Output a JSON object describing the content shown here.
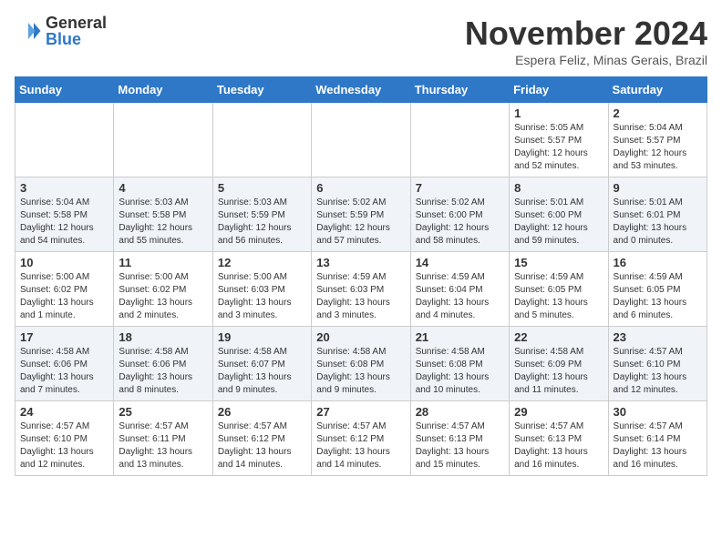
{
  "logo": {
    "general": "General",
    "blue": "Blue"
  },
  "header": {
    "month": "November 2024",
    "location": "Espera Feliz, Minas Gerais, Brazil"
  },
  "weekdays": [
    "Sunday",
    "Monday",
    "Tuesday",
    "Wednesday",
    "Thursday",
    "Friday",
    "Saturday"
  ],
  "weeks": [
    [
      {
        "day": "",
        "info": ""
      },
      {
        "day": "",
        "info": ""
      },
      {
        "day": "",
        "info": ""
      },
      {
        "day": "",
        "info": ""
      },
      {
        "day": "",
        "info": ""
      },
      {
        "day": "1",
        "info": "Sunrise: 5:05 AM\nSunset: 5:57 PM\nDaylight: 12 hours\nand 52 minutes."
      },
      {
        "day": "2",
        "info": "Sunrise: 5:04 AM\nSunset: 5:57 PM\nDaylight: 12 hours\nand 53 minutes."
      }
    ],
    [
      {
        "day": "3",
        "info": "Sunrise: 5:04 AM\nSunset: 5:58 PM\nDaylight: 12 hours\nand 54 minutes."
      },
      {
        "day": "4",
        "info": "Sunrise: 5:03 AM\nSunset: 5:58 PM\nDaylight: 12 hours\nand 55 minutes."
      },
      {
        "day": "5",
        "info": "Sunrise: 5:03 AM\nSunset: 5:59 PM\nDaylight: 12 hours\nand 56 minutes."
      },
      {
        "day": "6",
        "info": "Sunrise: 5:02 AM\nSunset: 5:59 PM\nDaylight: 12 hours\nand 57 minutes."
      },
      {
        "day": "7",
        "info": "Sunrise: 5:02 AM\nSunset: 6:00 PM\nDaylight: 12 hours\nand 58 minutes."
      },
      {
        "day": "8",
        "info": "Sunrise: 5:01 AM\nSunset: 6:00 PM\nDaylight: 12 hours\nand 59 minutes."
      },
      {
        "day": "9",
        "info": "Sunrise: 5:01 AM\nSunset: 6:01 PM\nDaylight: 13 hours\nand 0 minutes."
      }
    ],
    [
      {
        "day": "10",
        "info": "Sunrise: 5:00 AM\nSunset: 6:02 PM\nDaylight: 13 hours\nand 1 minute."
      },
      {
        "day": "11",
        "info": "Sunrise: 5:00 AM\nSunset: 6:02 PM\nDaylight: 13 hours\nand 2 minutes."
      },
      {
        "day": "12",
        "info": "Sunrise: 5:00 AM\nSunset: 6:03 PM\nDaylight: 13 hours\nand 3 minutes."
      },
      {
        "day": "13",
        "info": "Sunrise: 4:59 AM\nSunset: 6:03 PM\nDaylight: 13 hours\nand 3 minutes."
      },
      {
        "day": "14",
        "info": "Sunrise: 4:59 AM\nSunset: 6:04 PM\nDaylight: 13 hours\nand 4 minutes."
      },
      {
        "day": "15",
        "info": "Sunrise: 4:59 AM\nSunset: 6:05 PM\nDaylight: 13 hours\nand 5 minutes."
      },
      {
        "day": "16",
        "info": "Sunrise: 4:59 AM\nSunset: 6:05 PM\nDaylight: 13 hours\nand 6 minutes."
      }
    ],
    [
      {
        "day": "17",
        "info": "Sunrise: 4:58 AM\nSunset: 6:06 PM\nDaylight: 13 hours\nand 7 minutes."
      },
      {
        "day": "18",
        "info": "Sunrise: 4:58 AM\nSunset: 6:06 PM\nDaylight: 13 hours\nand 8 minutes."
      },
      {
        "day": "19",
        "info": "Sunrise: 4:58 AM\nSunset: 6:07 PM\nDaylight: 13 hours\nand 9 minutes."
      },
      {
        "day": "20",
        "info": "Sunrise: 4:58 AM\nSunset: 6:08 PM\nDaylight: 13 hours\nand 9 minutes."
      },
      {
        "day": "21",
        "info": "Sunrise: 4:58 AM\nSunset: 6:08 PM\nDaylight: 13 hours\nand 10 minutes."
      },
      {
        "day": "22",
        "info": "Sunrise: 4:58 AM\nSunset: 6:09 PM\nDaylight: 13 hours\nand 11 minutes."
      },
      {
        "day": "23",
        "info": "Sunrise: 4:57 AM\nSunset: 6:10 PM\nDaylight: 13 hours\nand 12 minutes."
      }
    ],
    [
      {
        "day": "24",
        "info": "Sunrise: 4:57 AM\nSunset: 6:10 PM\nDaylight: 13 hours\nand 12 minutes."
      },
      {
        "day": "25",
        "info": "Sunrise: 4:57 AM\nSunset: 6:11 PM\nDaylight: 13 hours\nand 13 minutes."
      },
      {
        "day": "26",
        "info": "Sunrise: 4:57 AM\nSunset: 6:12 PM\nDaylight: 13 hours\nand 14 minutes."
      },
      {
        "day": "27",
        "info": "Sunrise: 4:57 AM\nSunset: 6:12 PM\nDaylight: 13 hours\nand 14 minutes."
      },
      {
        "day": "28",
        "info": "Sunrise: 4:57 AM\nSunset: 6:13 PM\nDaylight: 13 hours\nand 15 minutes."
      },
      {
        "day": "29",
        "info": "Sunrise: 4:57 AM\nSunset: 6:13 PM\nDaylight: 13 hours\nand 16 minutes."
      },
      {
        "day": "30",
        "info": "Sunrise: 4:57 AM\nSunset: 6:14 PM\nDaylight: 13 hours\nand 16 minutes."
      }
    ]
  ]
}
